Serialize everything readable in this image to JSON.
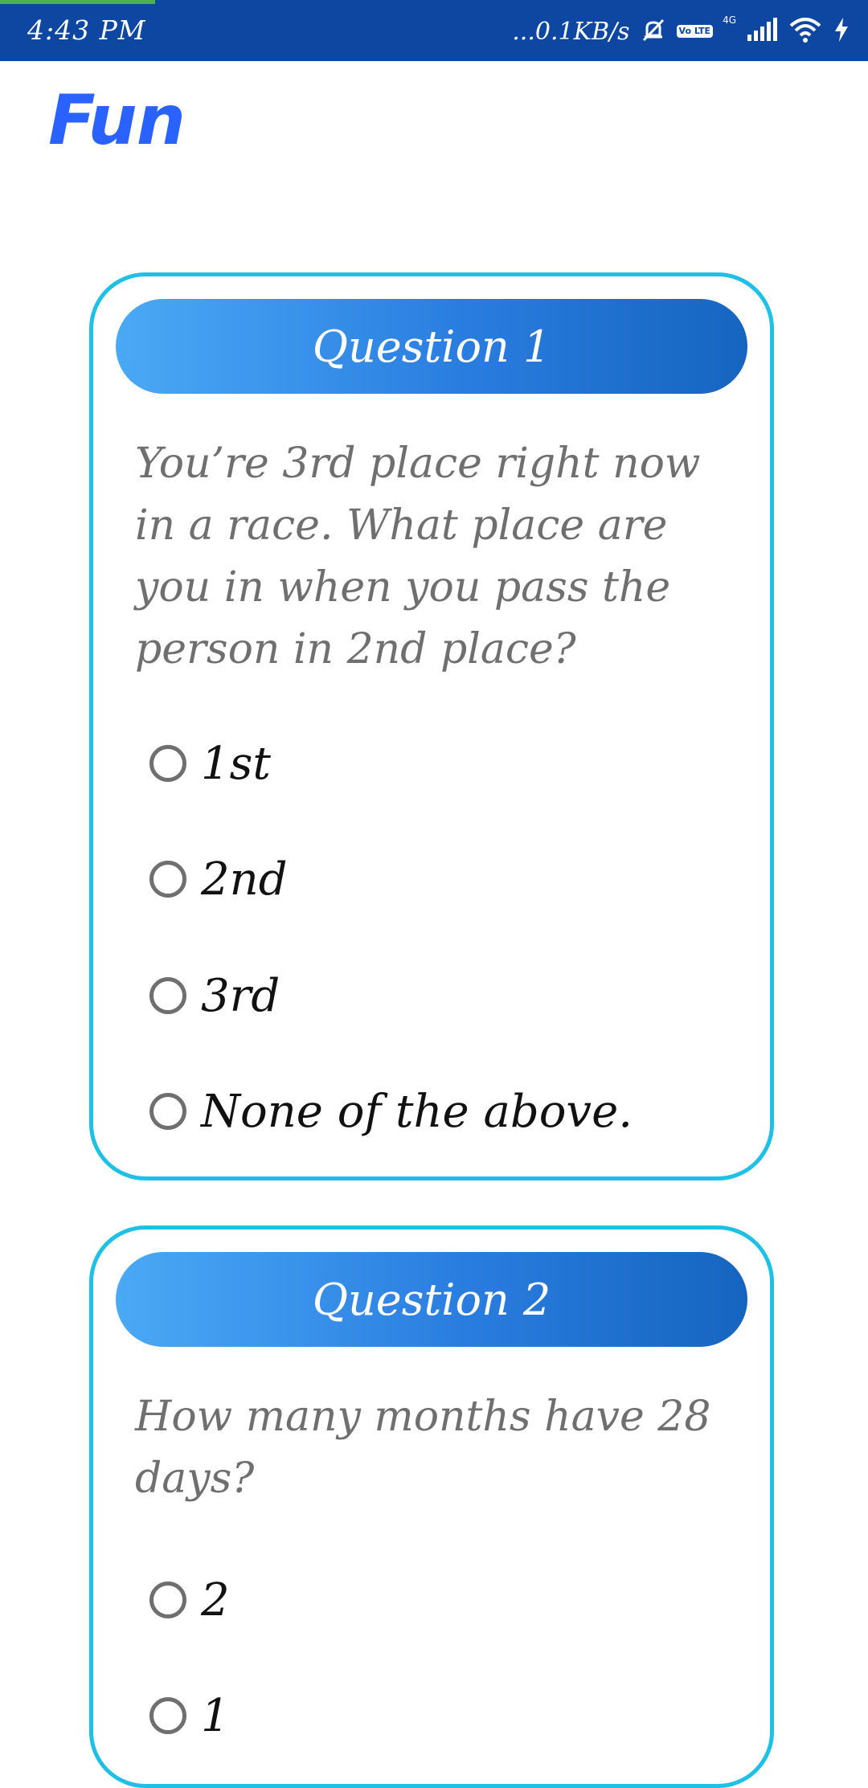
{
  "status_bar": {
    "time": "4:43 PM",
    "network_speed": "...0.1KB/s",
    "volte_label": "Vo LTE",
    "network_type": "4G",
    "icons": [
      "mute-icon",
      "volte-icon",
      "signal-icon",
      "wifi-icon",
      "charging-icon"
    ]
  },
  "app": {
    "title": "Fun"
  },
  "questions": [
    {
      "title": "Question 1",
      "text": "You’re 3rd place right now in a race. What place are you in when you pass the person in 2nd place?",
      "options": [
        "1st",
        "2nd",
        "3rd",
        "None of the above."
      ]
    },
    {
      "title": "Question 2",
      "text": "How many months have 28 days?",
      "options": [
        "2",
        "1"
      ]
    }
  ],
  "colors": {
    "status_bar": "#0d47a1",
    "title": "#2962ff",
    "card_border": "#1ec0e6",
    "header_gradient_start": "#4aa9f5",
    "header_gradient_end": "#1565c0",
    "question_text": "#6f6f6f",
    "option_text": "#111111"
  }
}
